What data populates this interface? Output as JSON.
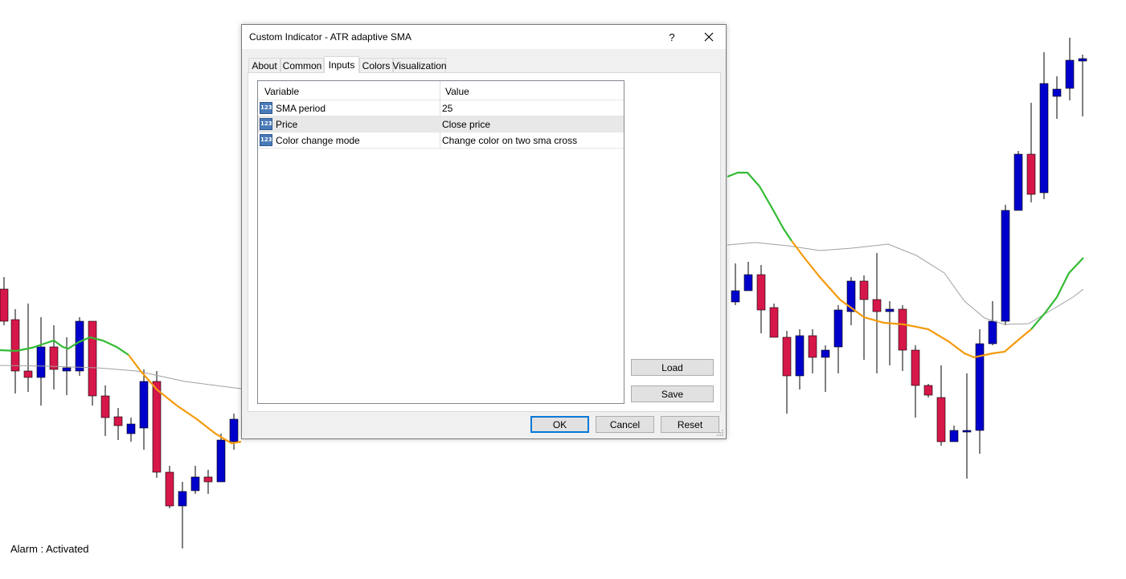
{
  "dialog": {
    "title": "Custom Indicator - ATR adaptive SMA",
    "help": "?",
    "tabs": [
      {
        "label": "About"
      },
      {
        "label": "Common"
      },
      {
        "label": "Inputs"
      },
      {
        "label": "Colors"
      },
      {
        "label": "Visualization"
      }
    ],
    "active_tab": "Inputs",
    "grid": {
      "col_variable": "Variable",
      "col_value": "Value",
      "rows": [
        {
          "variable": "SMA period",
          "value": "25"
        },
        {
          "variable": "Price",
          "value": "Close price"
        },
        {
          "variable": "Color change mode",
          "value": "Change color on two sma cross"
        }
      ],
      "icon_text": "123"
    },
    "buttons": {
      "load": "Load",
      "save": "Save",
      "ok": "OK",
      "cancel": "Cancel",
      "reset": "Reset"
    }
  },
  "status": {
    "alarm": "Alarm : Activated"
  },
  "colors": {
    "bull": "#0000cc",
    "bear": "#d6174a",
    "sma_up": "#33bb33",
    "sma_down": "#f59a0c",
    "sma_slow": "#a0a0a0"
  }
}
